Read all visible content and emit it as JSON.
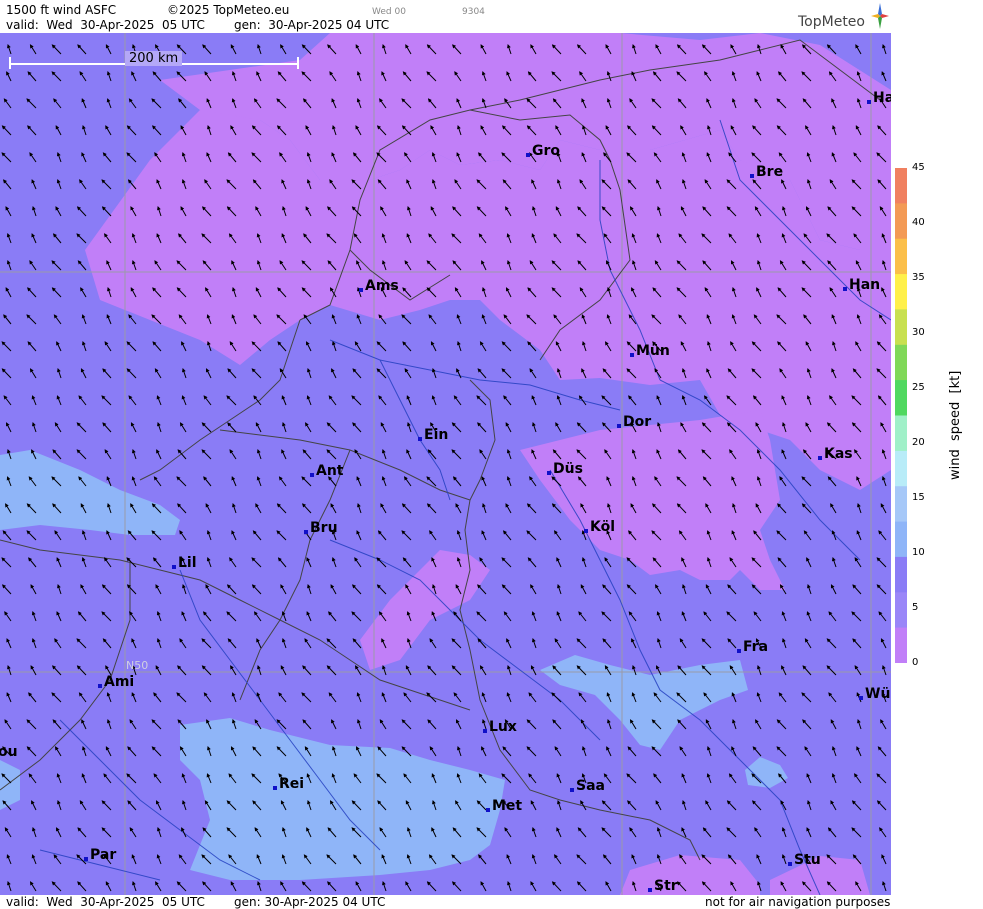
{
  "header": {
    "title": "1500 ft wind ASFC",
    "copyright": "©2025 TopMeteo.eu",
    "step": "Wed 00",
    "code": "9304",
    "valid": "valid:  Wed  30-Apr-2025  05 UTC",
    "gen": "gen:  30-Apr-2025 04 UTC"
  },
  "footer": {
    "valid": "valid:  Wed  30-Apr-2025  05 UTC",
    "gen": "gen: 30-Apr-2025 04 UTC",
    "note": "not for air navigation purposes"
  },
  "logo": {
    "text": "TopMeteo",
    "icon": "compass-star-icon"
  },
  "scale": {
    "label": "200 km"
  },
  "grid_label": "N50",
  "cities": [
    {
      "name": "Ha"
    },
    {
      "name": "Gro"
    },
    {
      "name": "Bre"
    },
    {
      "name": "Ams"
    },
    {
      "name": "Han"
    },
    {
      "name": "Mün"
    },
    {
      "name": "Dor"
    },
    {
      "name": "Ein"
    },
    {
      "name": "Düs"
    },
    {
      "name": "Kas"
    },
    {
      "name": "Ant"
    },
    {
      "name": "Köl"
    },
    {
      "name": "Bru"
    },
    {
      "name": "Lil"
    },
    {
      "name": "Fra"
    },
    {
      "name": "Ami"
    },
    {
      "name": "Wü"
    },
    {
      "name": "Lux"
    },
    {
      "name": "ou"
    },
    {
      "name": "Rei"
    },
    {
      "name": "Saa"
    },
    {
      "name": "Met"
    },
    {
      "name": "Par"
    },
    {
      "name": "Stu"
    },
    {
      "name": "Str"
    }
  ],
  "legend": {
    "label": "wind  speed  [kt]",
    "ticks": [
      "45",
      "40",
      "35",
      "30",
      "25",
      "20",
      "15",
      "10",
      "5",
      "0"
    ],
    "colors": [
      "#f08060",
      "#f39a55",
      "#fbbf4a",
      "#fff04a",
      "#c8e050",
      "#80d858",
      "#50d860",
      "#a0f0c8",
      "#b8ecf8",
      "#a6c8f8",
      "#8fb5f8",
      "#8a7cf6",
      "#9a86f8",
      "#c17ff8"
    ]
  },
  "colors": {
    "purple": "#c17ff8",
    "violet": "#8a7cf6",
    "lightblue": "#8fb5f8"
  }
}
